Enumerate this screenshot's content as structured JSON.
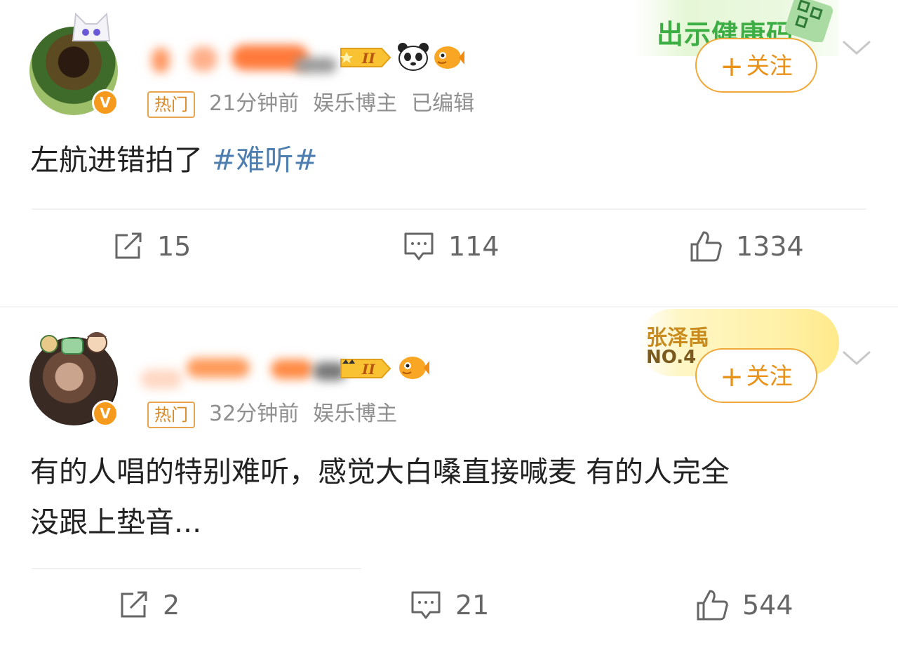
{
  "posts": [
    {
      "hot_label": "热门",
      "time": "21分钟前",
      "role": "娱乐博主",
      "edited": "已编辑",
      "verified_badge": "V",
      "level_badge": "II",
      "decoration_badge": "出示健康码",
      "follow_label": "关注",
      "content_text": "左航进错拍了 ",
      "content_tag": "#难听#",
      "reposts": "15",
      "comments": "114",
      "likes": "1334"
    },
    {
      "hot_label": "热门",
      "time": "32分钟前",
      "role": "娱乐博主",
      "verified_badge": "V",
      "level_badge": "II",
      "decoration_badge": "张泽禹",
      "decoration_no": "NO.4",
      "follow_label": "关注",
      "content_line1": "有的人唱的特别难听，感觉大白嗓直接喊麦 有的人完全",
      "content_line2": "没跟上垫音...",
      "reposts": "2",
      "comments": "21",
      "likes": "544"
    }
  ],
  "icons": [
    "repost-icon",
    "comment-icon",
    "like-icon",
    "chevron-down-icon",
    "verified-icon",
    "panda-icon",
    "fish-icon",
    "qr-code-icon"
  ],
  "colors": {
    "accent": "#f0a838",
    "tag": "#4e7fb0",
    "meta": "#8f8f8f",
    "hot": "#d98a28"
  }
}
